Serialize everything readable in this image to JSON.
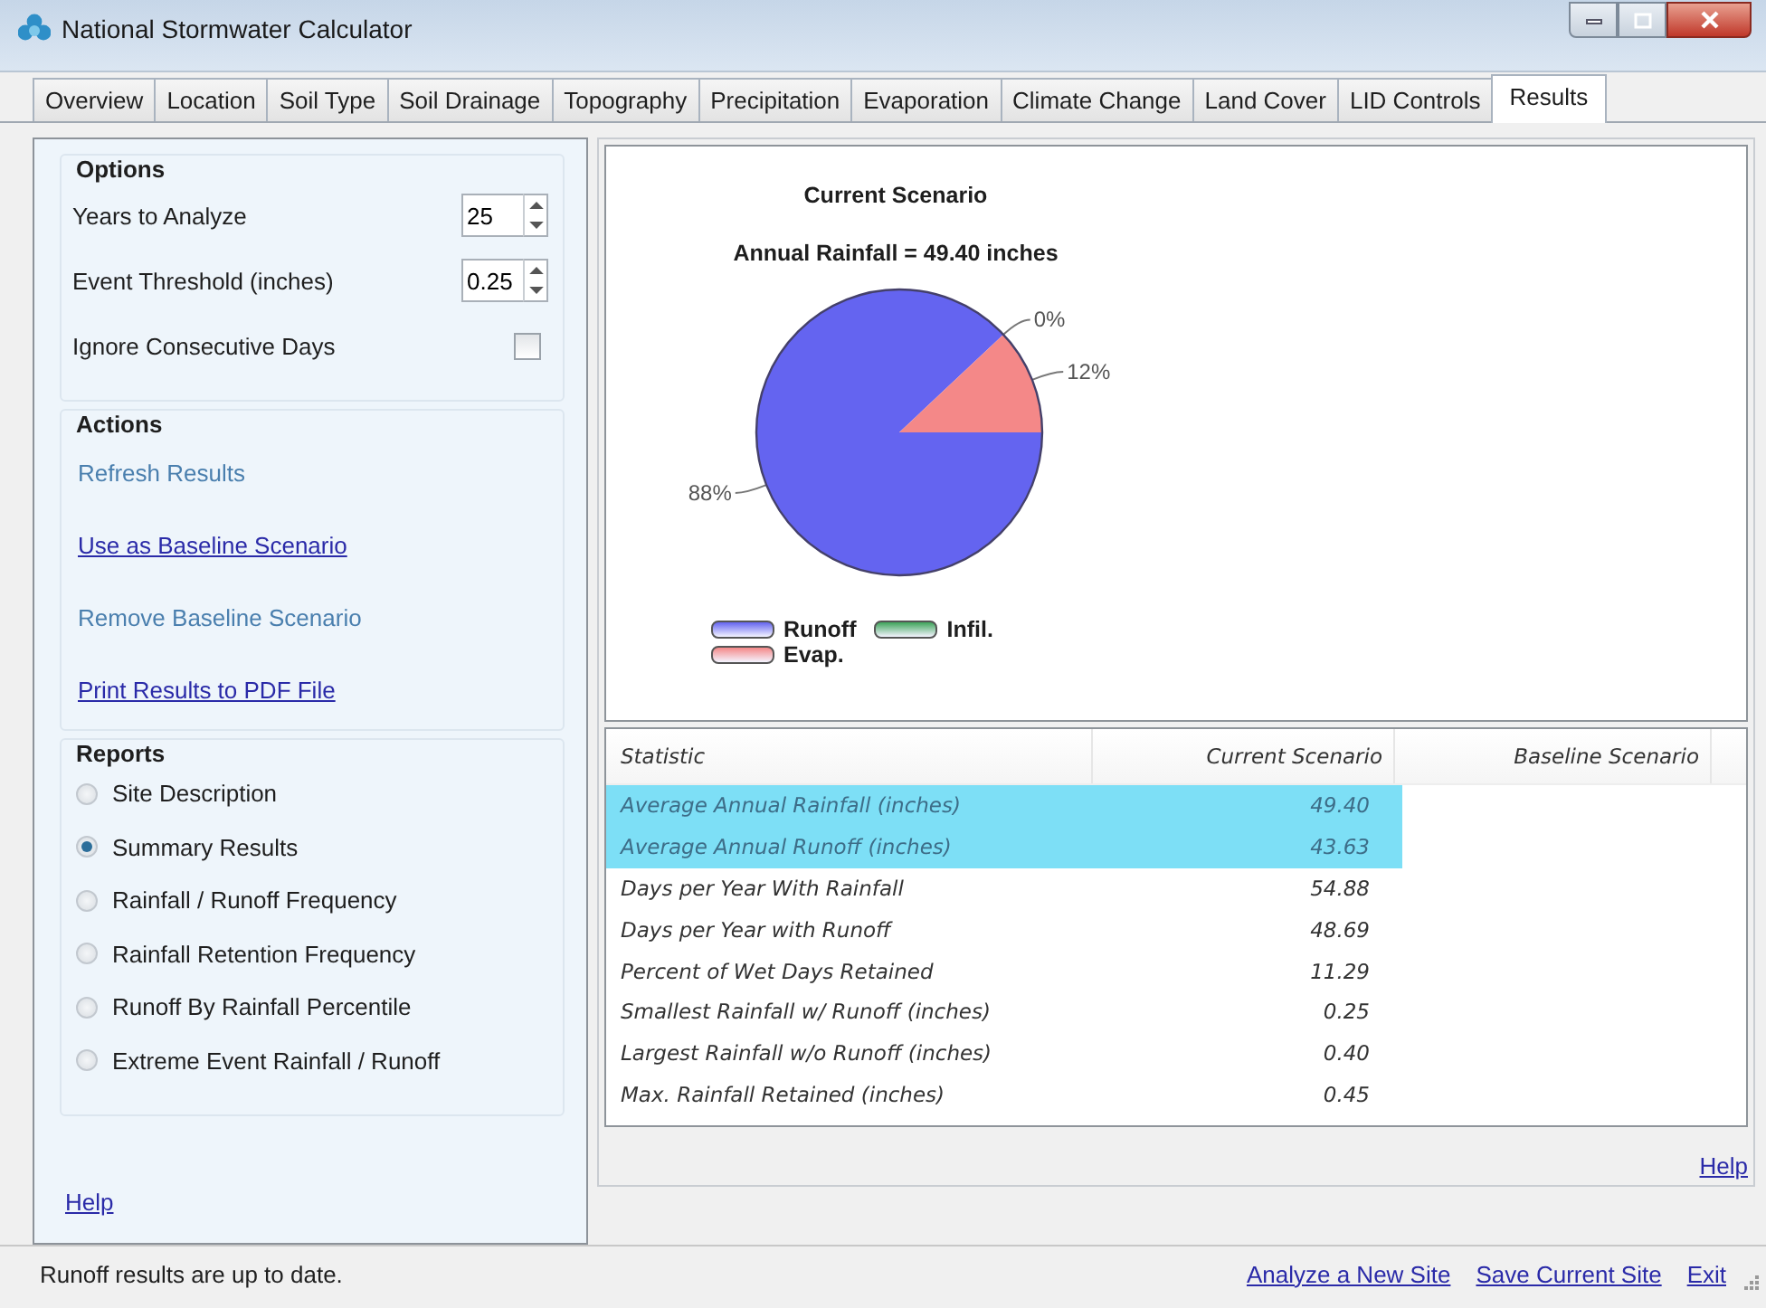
{
  "window": {
    "title": "National Stormwater Calculator"
  },
  "tabs": [
    {
      "label": "Overview",
      "selected": false
    },
    {
      "label": "Location",
      "selected": false
    },
    {
      "label": "Soil Type",
      "selected": false
    },
    {
      "label": "Soil Drainage",
      "selected": false
    },
    {
      "label": "Topography",
      "selected": false
    },
    {
      "label": "Precipitation",
      "selected": false
    },
    {
      "label": "Evaporation",
      "selected": false
    },
    {
      "label": "Climate Change",
      "selected": false
    },
    {
      "label": "Land Cover",
      "selected": false
    },
    {
      "label": "LID Controls",
      "selected": false
    },
    {
      "label": "Results",
      "selected": true
    }
  ],
  "options": {
    "title": "Options",
    "fields": [
      {
        "label": "Years to Analyze",
        "value": "25"
      },
      {
        "label": "Event Threshold (inches)",
        "value": "0.25"
      }
    ],
    "checkbox": {
      "label": "Ignore Consecutive Days",
      "checked": false
    }
  },
  "actions": {
    "title": "Actions",
    "items": [
      {
        "label": "Refresh Results",
        "disabled": true
      },
      {
        "label": "Use as Baseline Scenario",
        "disabled": false
      },
      {
        "label": "Remove Baseline Scenario",
        "disabled": true
      },
      {
        "label": "Print Results to PDF File",
        "disabled": false
      }
    ]
  },
  "reports": {
    "title": "Reports",
    "items": [
      {
        "label": "Site Description",
        "selected": false
      },
      {
        "label": "Summary Results",
        "selected": true
      },
      {
        "label": "Rainfall / Runoff Frequency",
        "selected": false
      },
      {
        "label": "Rainfall Retention Frequency",
        "selected": false
      },
      {
        "label": "Runoff By Rainfall Percentile",
        "selected": false
      },
      {
        "label": "Extreme Event Rainfall / Runoff",
        "selected": false
      }
    ]
  },
  "left_help": "Help",
  "chart": {
    "chart_data": {
      "type": "pie",
      "title": "Current Scenario",
      "subtitle": "Annual Rainfall = 49.40 inches",
      "categories": [
        "Runoff",
        "Infil.",
        "Evap."
      ],
      "values": [
        88,
        0,
        12
      ],
      "value_labels": [
        "88%",
        "0%",
        "12%"
      ],
      "colors": [
        "#6464f0",
        "#3ea45a",
        "#f48888"
      ],
      "legend": "bottom"
    }
  },
  "table": {
    "columns": [
      "Statistic",
      "Current Scenario",
      "Baseline Scenario"
    ],
    "rows": [
      {
        "cells": [
          "Average Annual Rainfall (inches)",
          "49.40"
        ],
        "selected": true
      },
      {
        "cells": [
          "Average Annual Runoff (inches)",
          "43.63"
        ],
        "selected": true
      },
      {
        "cells": [
          "Days per Year With Rainfall",
          "54.88"
        ],
        "selected": false
      },
      {
        "cells": [
          "Days per Year with Runoff",
          "48.69"
        ],
        "selected": false
      },
      {
        "cells": [
          "Percent of Wet Days Retained",
          "11.29"
        ],
        "selected": false
      },
      {
        "cells": [
          "Smallest Rainfall w/ Runoff (inches)",
          "0.25"
        ],
        "selected": false
      },
      {
        "cells": [
          "Largest Rainfall w/o Runoff (inches)",
          "0.40"
        ],
        "selected": false
      },
      {
        "cells": [
          "Max. Rainfall Retained (inches)",
          "0.45"
        ],
        "selected": false
      }
    ]
  },
  "right_help": "Help",
  "status_bar": {
    "message": "Runoff results are up to date.",
    "links": [
      "Analyze a New Site",
      "Save Current Site",
      "Exit"
    ]
  }
}
